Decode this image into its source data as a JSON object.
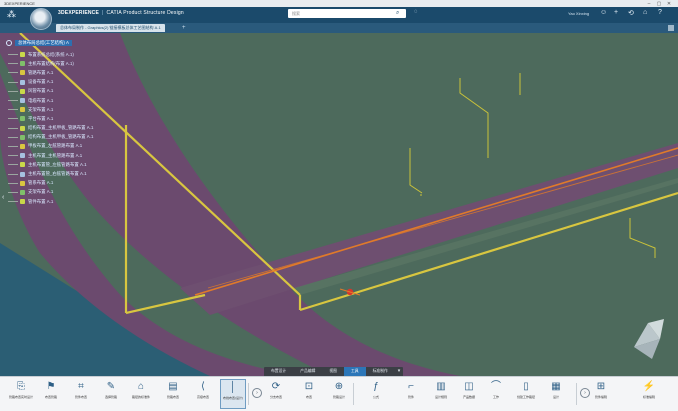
{
  "window": {
    "title": "3DEXPERIENCE"
  },
  "header": {
    "brand": "3DEXPERIENCE",
    "product": "CATIA Product Structure Design",
    "search_placeholder": "搜索",
    "user_name": "Yao Xinxing"
  },
  "tab": {
    "label": "总体布局制作 - Graphics(2)  链接模板总体工艺图结构 A.1"
  },
  "tree": {
    "root": "总体布局总结(工艺结构) A",
    "items": [
      "布置系统总结(系统 A.1)",
      "主机布置结构(布置 A.1)",
      "管路布置 A.1",
      "设备布置 A.1",
      "风管布置 A.1",
      "电缆布置 A.1",
      "支架布置 A.1",
      "平台布置 A.1",
      "结构布置_主机甲板_管路布置 A.1",
      "结构布置_主机甲板_管路布置 A.1",
      "甲板布置_左舷管路布置 A.1",
      "主机布置_主机管路布置 A.1",
      "主机布置管_左舷管路布置 A.1",
      "主机布置管_右舷管路布置 A.1",
      "管系布置 A.1",
      "支架布置 A.1",
      "管件布置 A.1"
    ]
  },
  "section_tabs": [
    "布置设计",
    "产品编辑",
    "视图",
    "工具",
    "标准制作"
  ],
  "active_section": "工具",
  "toolbar": [
    "管路布置实时设计",
    "布置管路",
    "管件布置",
    "选择管路",
    "路径的标准件",
    "管路布置",
    "高级布置",
    "布线布置(设计)",
    "分支布置",
    "布置",
    "管路设计",
    "公式",
    "管件",
    "设计规则",
    "产品数据",
    "工作",
    "创建工作路径",
    "设计",
    "管件编辑",
    "标准编辑"
  ],
  "colors": {
    "header_bg": "#1b4a6b",
    "viewport_green": "#4f6a5c",
    "viewport_purple": "#6b4a6e",
    "viewport_teal": "#2b5e74",
    "pipe_yellow": "#d8c640",
    "pipe_orange": "#e07a2a"
  },
  "icons": {
    "compass": "compass-icon",
    "search": "search-icon",
    "add": "plus-icon",
    "share": "share-icon",
    "home": "home-icon",
    "tree_root": "product-root-icon"
  }
}
